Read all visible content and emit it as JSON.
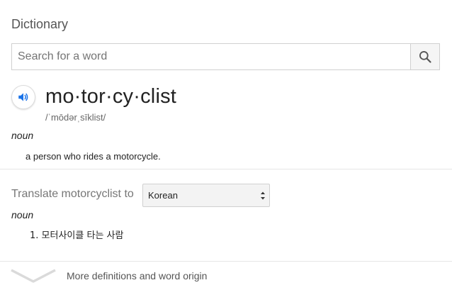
{
  "dictionary": {
    "title": "Dictionary",
    "search": {
      "placeholder": "Search for a word",
      "value": ""
    },
    "entry": {
      "headword": "mo·tor·cy·clist",
      "phonetic": "/ˈmōdərˌsīklist/",
      "part_of_speech": "noun",
      "definition": "a person who rides a motorcycle."
    },
    "translate": {
      "label": "Translate motorcyclist to",
      "selected_language": "Korean",
      "part_of_speech": "noun",
      "items": [
        {
          "number": "1.",
          "text": "모터사이클 타는 사람"
        }
      ]
    },
    "more_link": "More definitions and word origin"
  },
  "colors": {
    "speaker_blue": "#1a73e8",
    "text": "#222222",
    "muted": "#777777",
    "border": "#d0d0d0"
  },
  "icons": [
    "search-icon",
    "speaker-icon",
    "select-arrows-icon",
    "chevron-down-icon"
  ]
}
